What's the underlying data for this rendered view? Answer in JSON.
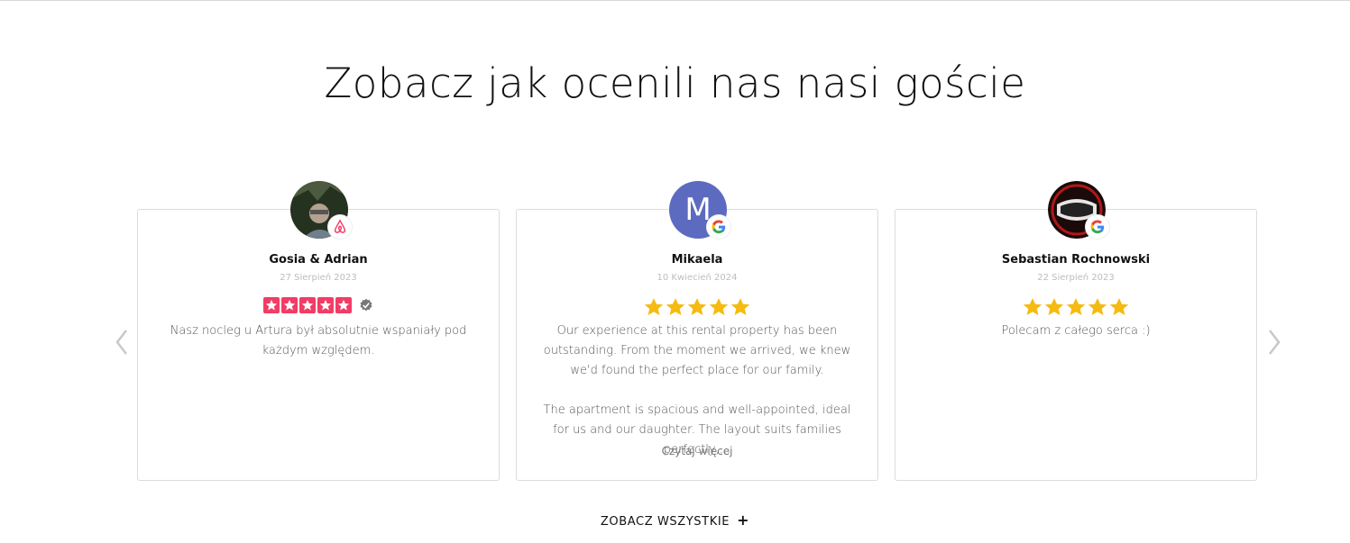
{
  "section": {
    "title": "Zobacz jak ocenili nas nasi goście",
    "see_all_label": "ZOBACZ WSZYSTKIE",
    "see_all_icon": "+"
  },
  "colors": {
    "airbnb_star": "#f23c66",
    "google_star": "#f5bb10",
    "avatar_bg_m": "#5c6bc0",
    "verified": "#777777"
  },
  "reviews": [
    {
      "name": "Gosia & Adrian",
      "date": "27 Sierpień 2023",
      "rating": 5,
      "source": "airbnb-icon",
      "verified": true,
      "text": [
        "Nasz nocleg u Artura był absolutnie wspaniały pod każdym względem."
      ]
    },
    {
      "name": "Mikaela",
      "avatar_letter": "M",
      "date": "10 Kwiecień 2024",
      "rating": 5,
      "source": "google-icon",
      "text": [
        "Our experience at this rental property has been outstanding. From the moment we arrived, we knew we'd found the perfect place for our family.",
        "The apartment is spacious and well-appointed, ideal for us and our daughter. The layout suits families perfectly,..."
      ],
      "read_more": "Czytaj więcej"
    },
    {
      "name": "Sebastian Rochnowski",
      "date": "22 Sierpień 2023",
      "rating": 5,
      "source": "google-icon",
      "text": [
        "Polecam z całego serca :)"
      ]
    }
  ],
  "nav": {
    "prev_icon": "chevron-left-icon",
    "next_icon": "chevron-right-icon"
  }
}
